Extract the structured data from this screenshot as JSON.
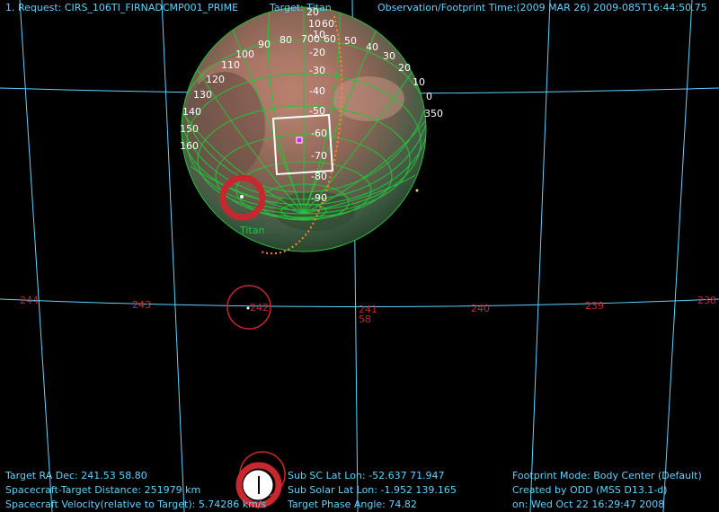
{
  "header": {
    "request": "1. Request: CIRS_106TI_FIRNADCMP001_PRIME",
    "target": "Target: Titan",
    "obs_time": "Observation/Footprint Time:(2009 MAR 26) 2009-085T16:44:50.75"
  },
  "body_label": "Titan",
  "globe": {
    "lat_labels": [
      "-10",
      "-20",
      "-30",
      "-40",
      "-50",
      "-60",
      "-70",
      "-80",
      "-90"
    ],
    "lon_labels_left": [
      "90",
      "80",
      "100",
      "110",
      "120",
      "130",
      "140",
      "150",
      "160"
    ],
    "lon_labels_right": [
      "60",
      "50",
      "40",
      "30",
      "20",
      "10",
      "0",
      "350"
    ],
    "top_labels": [
      "20",
      "10",
      "700",
      "60"
    ]
  },
  "ra_labels": [
    "244",
    "243",
    "242",
    "241",
    "240",
    "239",
    "238"
  ],
  "dec_label": "58",
  "info_left": {
    "ra_dec": "Target RA Dec: 241.53  58.80",
    "distance": "Spacecraft-Target Distance:  251979 km",
    "velocity": "Spacecraft Velocity(relative to Target): 5.74286 km/s"
  },
  "info_mid": {
    "sub_sc": "Sub SC Lat Lon: -52.637  71.947",
    "sub_solar": "Sub Solar Lat Lon: -1.952  139.165",
    "phase": "Target Phase Angle: 74.82"
  },
  "info_right": {
    "mode": "Footprint Mode: Body Center (Default)",
    "created": "Created by ODD (MSS D13.1-d)",
    "date": "on: Wed Oct 22 16:29:47 2008"
  },
  "colors": {
    "grid": "#5fd3ff",
    "globe_grid": "#27c23a",
    "red": "#c8282d",
    "orange": "#ff8a1f"
  }
}
